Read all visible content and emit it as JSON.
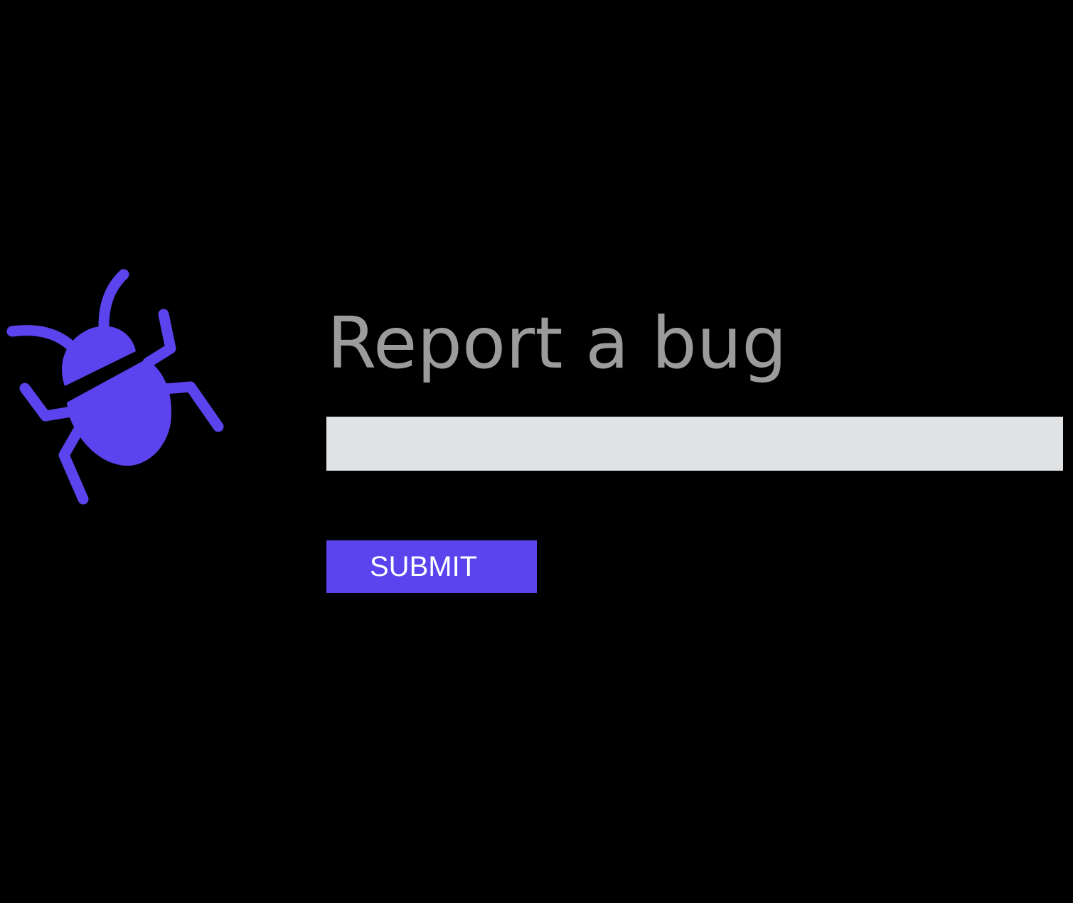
{
  "form": {
    "title": "Report a bug",
    "input_value": "",
    "submit_label": "SUBMIT"
  },
  "icons": {
    "bug": "bug-icon"
  },
  "colors": {
    "accent": "#5b44ee",
    "title_text": "#9b9b9b",
    "input_background": "#e1e2e4",
    "page_background": "#000000",
    "button_text": "#ffffff"
  }
}
